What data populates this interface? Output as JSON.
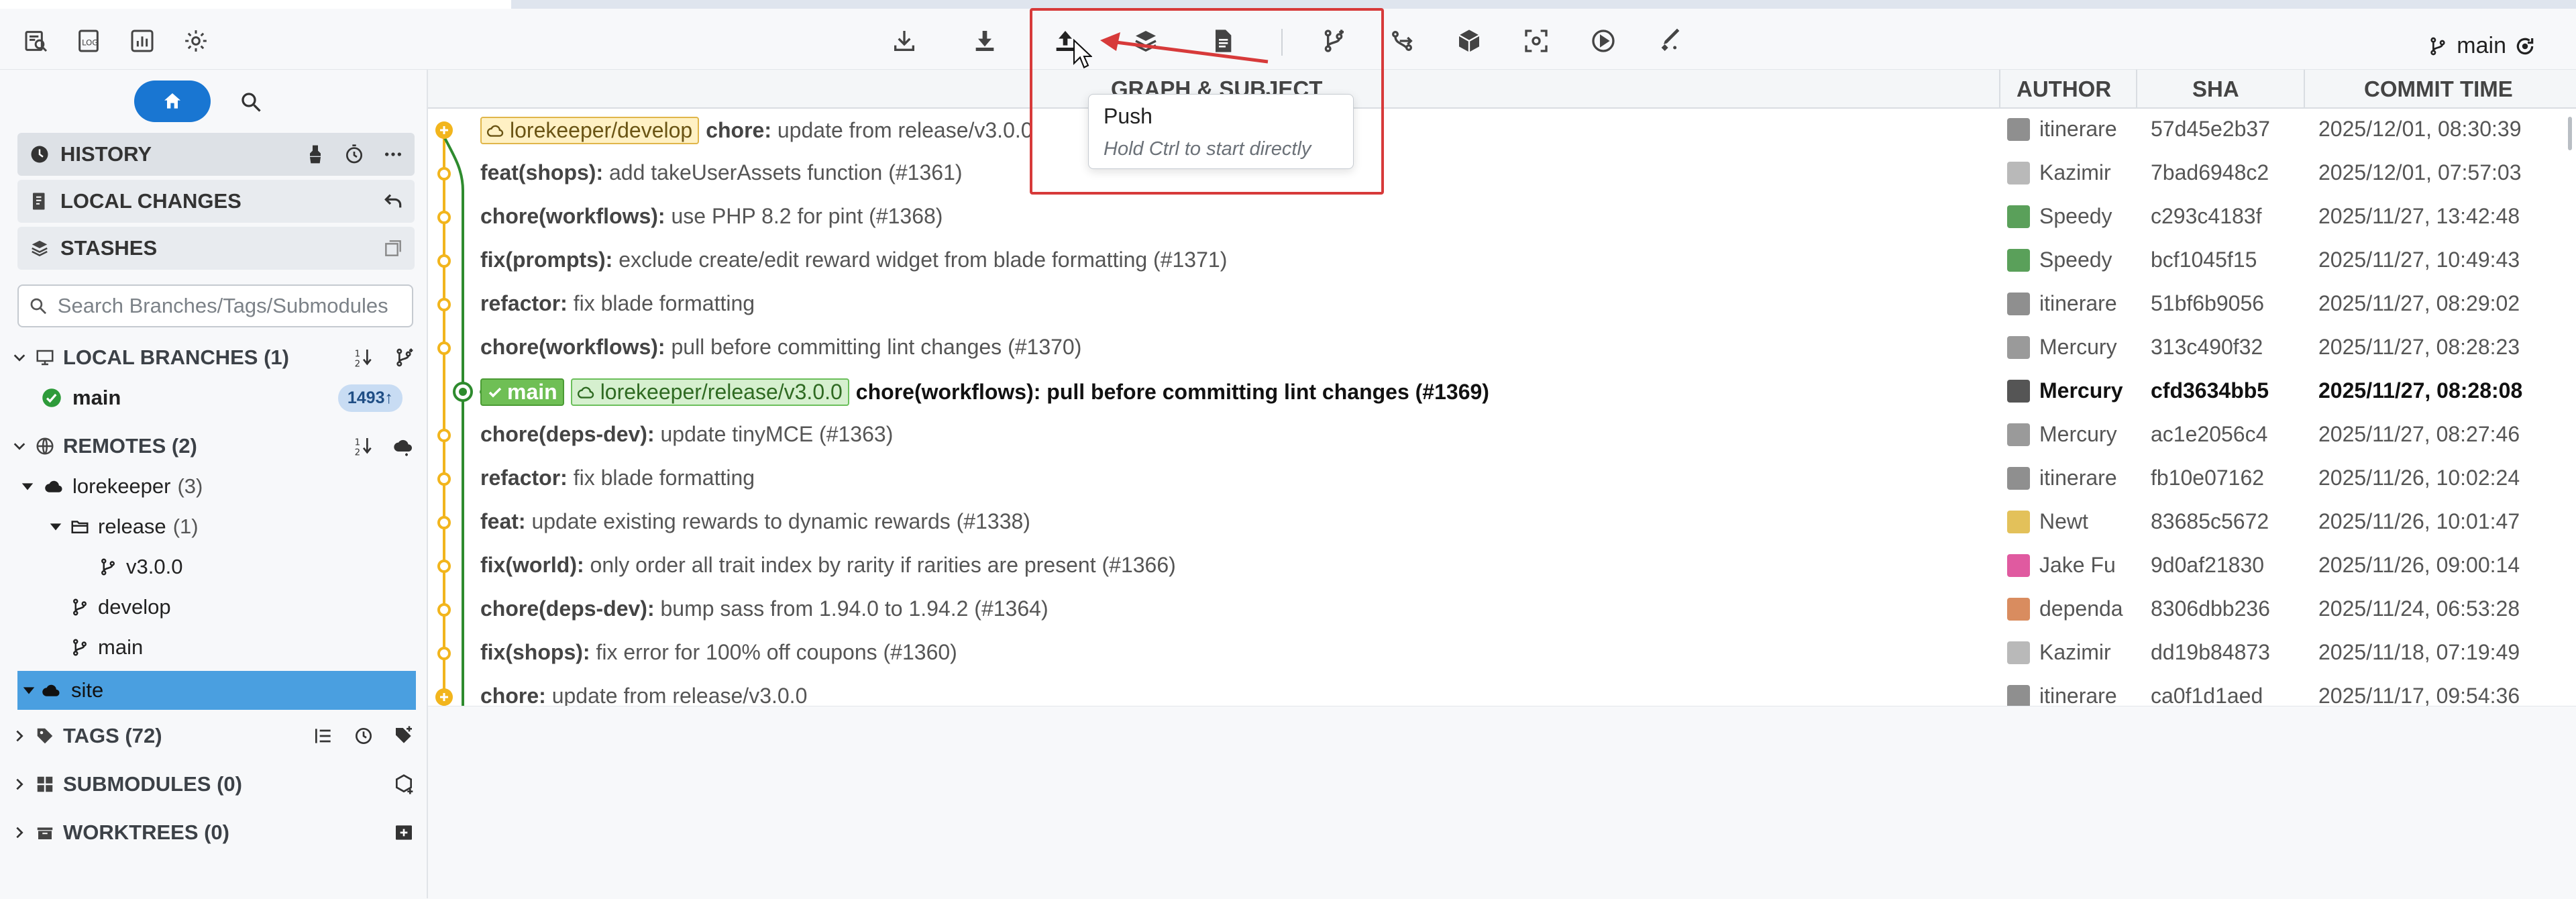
{
  "toolbar": {
    "left_icons": [
      "open-repo-icon",
      "log-icon",
      "stats-icon",
      "settings-icon"
    ],
    "center_icons": [
      "fetch-icon",
      "pull-icon",
      "push-icon",
      "stash-icon",
      "apply-patch-icon",
      "new-branch-icon",
      "merge-icon",
      "archive-icon",
      "screenshot-icon",
      "run-icon",
      "cleanup-icon"
    ],
    "current_branch": "main"
  },
  "tooltip": {
    "title": "Push",
    "hint": "Hold Ctrl to start directly"
  },
  "sidebar": {
    "panels": {
      "history": "HISTORY",
      "local_changes": "LOCAL CHANGES",
      "stashes": "STASHES"
    },
    "search_placeholder": "Search Branches/Tags/Submodules",
    "local_branches_label": "LOCAL BRANCHES (1)",
    "local_branch": {
      "name": "main",
      "badge": "1493↑"
    },
    "remotes_label": "REMOTES (2)",
    "remote1": {
      "name": "lorekeeper",
      "count": "(3)"
    },
    "folder_release": {
      "name": "release",
      "count": "(1)"
    },
    "branch_v3": "v3.0.0",
    "branch_develop": "develop",
    "branch_main": "main",
    "remote2": "site",
    "tags_label": "TAGS (72)",
    "submodules_label": "SUBMODULES (0)",
    "worktrees_label": "WORKTREES (0)"
  },
  "columns": {
    "subject": "GRAPH & SUBJECT",
    "author": "AUTHOR",
    "sha": "SHA",
    "time": "COMMIT TIME"
  },
  "commits": [
    {
      "tags": [
        {
          "kind": "remote-yellow",
          "label": "lorekeeper/develop"
        }
      ],
      "prefix": "chore:",
      "message": " update from release/v3.0.0",
      "author": "itinerare",
      "sha": "57d45e2b37",
      "time": "2025/12/01, 08:30:39",
      "avatar_color": "#8f8f8f"
    },
    {
      "tags": [],
      "prefix": "feat(shops):",
      "message": " add takeUserAssets function (#1361)",
      "author": "Kazimir",
      "sha": "7bad6948c2",
      "time": "2025/12/01, 07:57:03",
      "avatar_color": "#b9b9b9"
    },
    {
      "tags": [],
      "prefix": "chore(workflows):",
      "message": " use PHP 8.2 for pint (#1368)",
      "author": "Speedy",
      "sha": "c293c4183f",
      "time": "2025/11/27, 13:42:48",
      "avatar_color": "#5aa05a"
    },
    {
      "tags": [],
      "prefix": "fix(prompts):",
      "message": " exclude create/edit reward widget from blade formatting (#1371)",
      "author": "Speedy",
      "sha": "bcf1045f15",
      "time": "2025/11/27, 10:49:43",
      "avatar_color": "#5aa05a"
    },
    {
      "tags": [],
      "prefix": "refactor:",
      "message": " fix blade formatting",
      "author": "itinerare",
      "sha": "51bf6b9056",
      "time": "2025/11/27, 08:29:02",
      "avatar_color": "#8f8f8f"
    },
    {
      "tags": [],
      "prefix": "chore(workflows):",
      "message": " pull before committing lint changes (#1370)",
      "author": "Mercury",
      "sha": "313c490f32",
      "time": "2025/11/27, 08:28:23",
      "avatar_color": "#9a9a9a"
    },
    {
      "tags": [
        {
          "kind": "head",
          "label": "main"
        },
        {
          "kind": "remote-green",
          "label": "lorekeeper/release/v3.0.0"
        }
      ],
      "prefix": "chore(workflows):",
      "message": " pull before committing lint changes (#1369)",
      "author": "Mercury",
      "sha": "cfd3634bb5",
      "time": "2025/11/27, 08:28:08",
      "avatar_color": "#555555",
      "head": true
    },
    {
      "tags": [],
      "prefix": "chore(deps-dev):",
      "message": " update tinyMCE (#1363)",
      "author": "Mercury",
      "sha": "ac1e2056c4",
      "time": "2025/11/27, 08:27:46",
      "avatar_color": "#9a9a9a"
    },
    {
      "tags": [],
      "prefix": "refactor:",
      "message": " fix blade formatting",
      "author": "itinerare",
      "sha": "fb10e07162",
      "time": "2025/11/26, 10:02:24",
      "avatar_color": "#8f8f8f"
    },
    {
      "tags": [],
      "prefix": "feat:",
      "message": " update existing rewards to dynamic rewards (#1338)",
      "author": "Newt",
      "sha": "83685c5672",
      "time": "2025/11/26, 10:01:47",
      "avatar_color": "#e3c15a"
    },
    {
      "tags": [],
      "prefix": "fix(world):",
      "message": " only order all trait index by rarity if rarities are present (#1366)",
      "author": "Jake Fu",
      "sha": "9d0af21830",
      "time": "2025/11/26, 09:00:14",
      "avatar_color": "#e05aa0"
    },
    {
      "tags": [],
      "prefix": "chore(deps-dev):",
      "message": " bump sass from 1.94.0 to 1.94.2 (#1364)",
      "author": "dependa",
      "sha": "8306dbb236",
      "time": "2025/11/24, 06:53:28",
      "avatar_color": "#d98c5f"
    },
    {
      "tags": [],
      "prefix": "fix(shops):",
      "message": " fix error for 100% off coupons (#1360)",
      "author": "Kazimir",
      "sha": "dd19b84873",
      "time": "2025/11/18, 07:19:49",
      "avatar_color": "#b9b9b9"
    },
    {
      "tags": [],
      "prefix": "chore:",
      "message": " update from release/v3.0.0",
      "author": "itinerare",
      "sha": "ca0f1d1aed",
      "time": "2025/11/17, 09:54:36",
      "avatar_color": "#8f8f8f"
    }
  ],
  "colors": {
    "accent": "#1976d2",
    "graph_yellow": "#f2b51d",
    "graph_green": "#2e8b2e",
    "highlight_red": "#d73a3a"
  }
}
